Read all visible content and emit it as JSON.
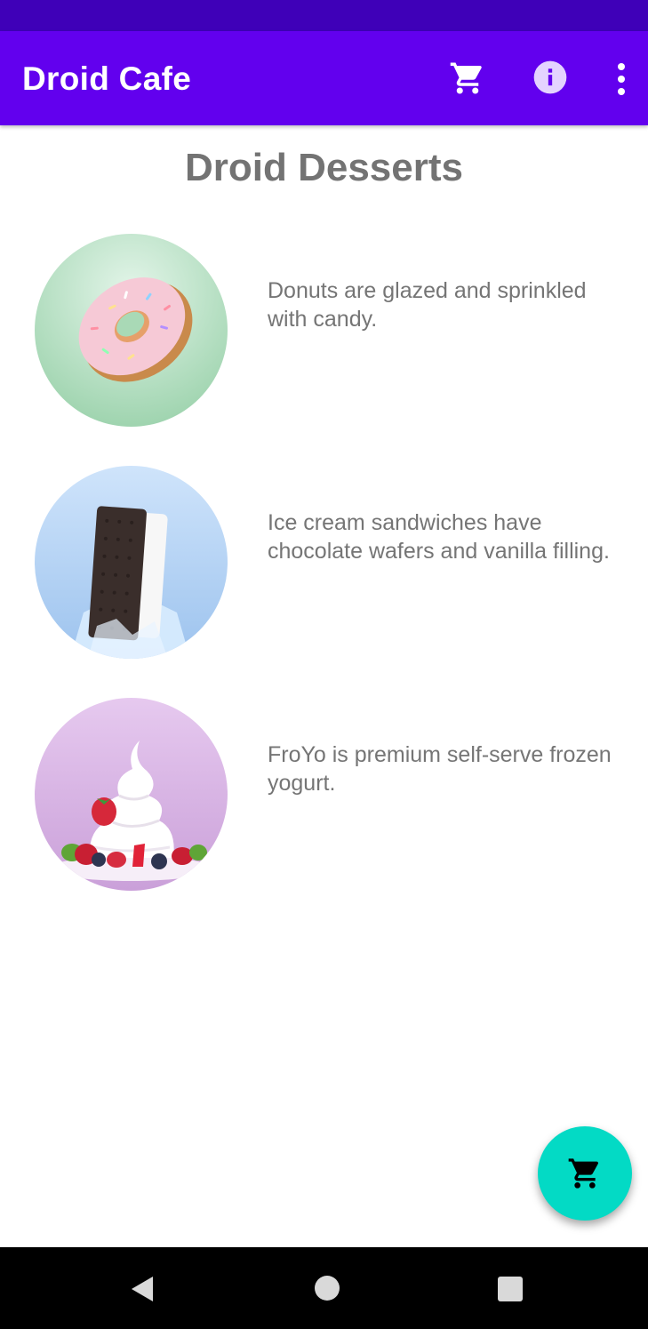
{
  "app_bar": {
    "title": "Droid Cafe",
    "icons": [
      "cart-icon",
      "info-icon",
      "more-vert-icon"
    ],
    "color": "#6200ee"
  },
  "status_bar": {
    "color": "#3f00b8"
  },
  "page": {
    "title": "Droid Desserts"
  },
  "desserts": [
    {
      "image": "donut-image",
      "description": "Donuts are glazed and sprinkled with candy."
    },
    {
      "image": "ice-cream-sandwich-image",
      "description": "Ice cream sandwiches have chocolate wafers and vanilla filling."
    },
    {
      "image": "froyo-image",
      "description": "FroYo is premium self-serve frozen yogurt."
    }
  ],
  "fab": {
    "icon": "cart-icon",
    "color": "#03dac5"
  },
  "nav_bar": {
    "icons": [
      "back-icon",
      "home-icon",
      "recents-icon"
    ]
  }
}
